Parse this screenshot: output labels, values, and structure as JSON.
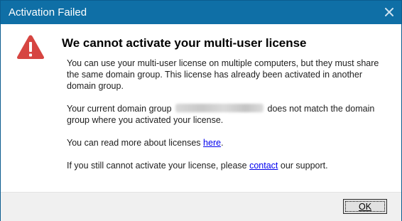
{
  "window": {
    "title": "Activation Failed"
  },
  "message": {
    "heading": "We cannot activate your multi-user license",
    "para1": "You can use your multi-user license on multiple computers, but they must share the same domain group. This license has already been activated in another domain group.",
    "para2_prefix": "Your current domain group",
    "para2_suffix": "does not match the domain group where you activated your license.",
    "para3_prefix": "You can read more about licenses",
    "para3_link": "here",
    "para3_suffix": ".",
    "para4_prefix": "If you still cannot activate your license, please",
    "para4_link": "contact",
    "para4_suffix": "our support."
  },
  "footer": {
    "ok_label": "OK"
  },
  "icons": {
    "warning": "warning-triangle-icon",
    "close": "close-icon"
  },
  "colors": {
    "titlebar": "#0f6fa6",
    "warning": "#d64541",
    "link": "#0000ee"
  }
}
